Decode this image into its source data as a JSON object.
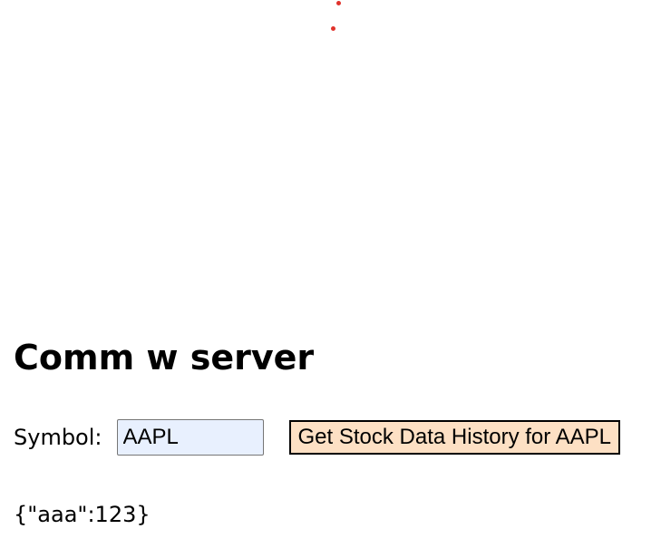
{
  "colors": {
    "dot": "#e0322b",
    "input_background": "#e8f0fe",
    "button_background": "#fde0c4",
    "button_border": "#000000"
  },
  "header": {
    "title": "Comm w server"
  },
  "form": {
    "symbol_label": "Symbol:",
    "symbol_value": "AAPL",
    "button_label": "Get Stock Data History for AAPL"
  },
  "output": {
    "result": "{\"aaa\":123}"
  }
}
